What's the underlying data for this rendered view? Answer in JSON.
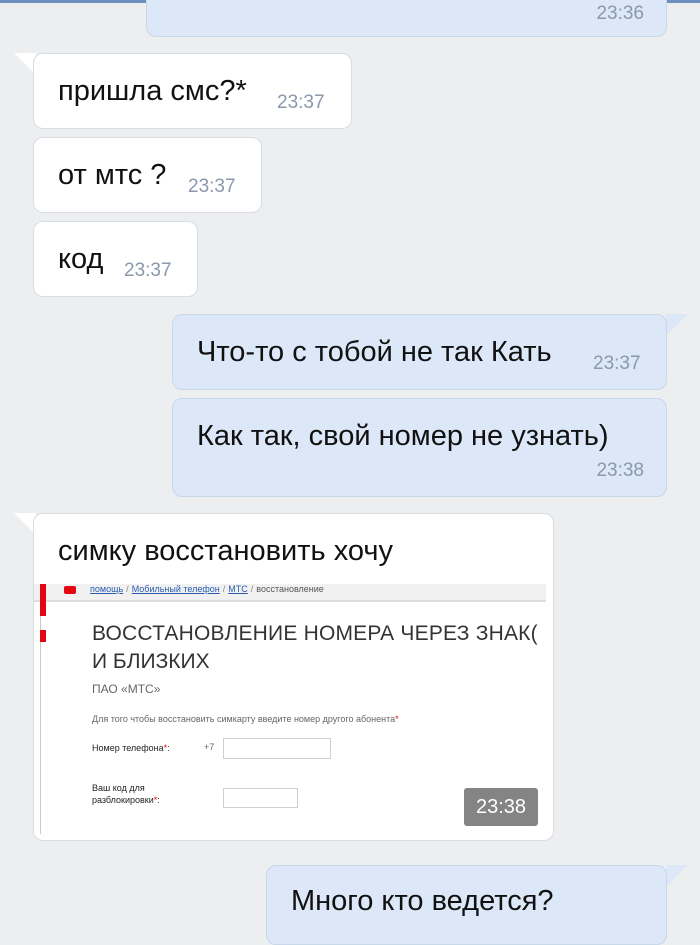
{
  "messages": [
    {
      "text": "",
      "time": "23:36"
    },
    {
      "text": "пришла смс?*",
      "time": "23:37"
    },
    {
      "text": "от мтс ?",
      "time": "23:37"
    },
    {
      "text": "код",
      "time": "23:37"
    },
    {
      "text": "Что-то с тобой не так Кать",
      "time": "23:37"
    },
    {
      "text": "Как так, свой номер не узнать)",
      "time": "23:38"
    },
    {
      "text": "симку восстановить хочу",
      "time": "23:38"
    },
    {
      "text": "Много кто ведется?",
      "time": ""
    }
  ],
  "attachment": {
    "breadcrumb": [
      "помощь",
      "Мобильный телефон",
      "МТС",
      "восстановление"
    ],
    "heading_line1": "ВОССТАНОВЛЕНИЕ НОМЕРА ЧЕРЕЗ ЗНАК(",
    "heading_line2": "И БЛИЗКИХ",
    "company": "ПАО «МТС»",
    "instruction": "Для того чтобы восстановить симкарту введите номер другого абонента",
    "phone_label": "Номер телефона",
    "phone_prefix": "+7",
    "code_label_line1": "Ваш код для",
    "code_label_line2": "разблокировки",
    "required_mark": "*"
  },
  "colors": {
    "incoming_bubble": "#ffffff",
    "outgoing_bubble": "#dce8f8",
    "background": "#edeef0",
    "timestamp": "#8a98ab",
    "mts_red": "#e30611"
  }
}
